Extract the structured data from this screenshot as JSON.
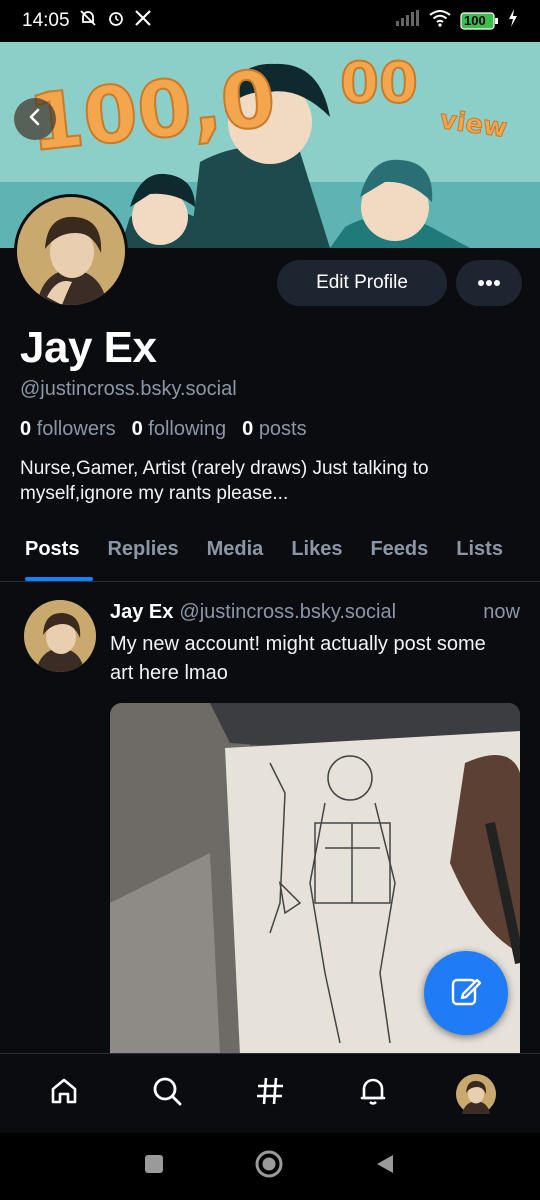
{
  "status_bar": {
    "time": "14:05",
    "battery": "100",
    "icons": [
      "muted-bell-icon",
      "alarm-icon",
      "x-logo-icon",
      "signal-icon",
      "wifi-icon",
      "battery-icon",
      "charging-icon"
    ]
  },
  "banner": {
    "text_big": "100,0",
    "text_view": "view",
    "back_icon": "chevron-left-icon"
  },
  "profile": {
    "edit_label": "Edit Profile",
    "more_label": "•••",
    "display_name": "Jay Ex",
    "handle": "@justincross.bsky.social",
    "followers_count": "0",
    "followers_label": "followers",
    "following_count": "0",
    "following_label": "following",
    "posts_count": "0",
    "posts_label": "posts",
    "bio": "Nurse,Gamer, Artist (rarely draws) Just talking to myself,ignore my rants please..."
  },
  "tabs": [
    {
      "label": "Posts",
      "active": true
    },
    {
      "label": "Replies",
      "active": false
    },
    {
      "label": "Media",
      "active": false
    },
    {
      "label": "Likes",
      "active": false
    },
    {
      "label": "Feeds",
      "active": false
    },
    {
      "label": "Lists",
      "active": false
    }
  ],
  "post": {
    "author_name": "Jay Ex",
    "author_handle": "@justincross.bsky.social",
    "time": "now",
    "text": "My new account! might actually post some art here lmao"
  },
  "bottom_nav": [
    "home-icon",
    "search-icon",
    "hashtag-icon",
    "notifications-bell-icon",
    "profile-avatar"
  ],
  "system_nav": [
    "recents-square-icon",
    "home-circle-icon",
    "back-triangle-icon"
  ],
  "colors": {
    "background": "#0a0c10",
    "accent": "#1083fe",
    "fab": "#1f7cf5",
    "muted_text": "#8b97a6",
    "button_bg": "#1e2530"
  }
}
